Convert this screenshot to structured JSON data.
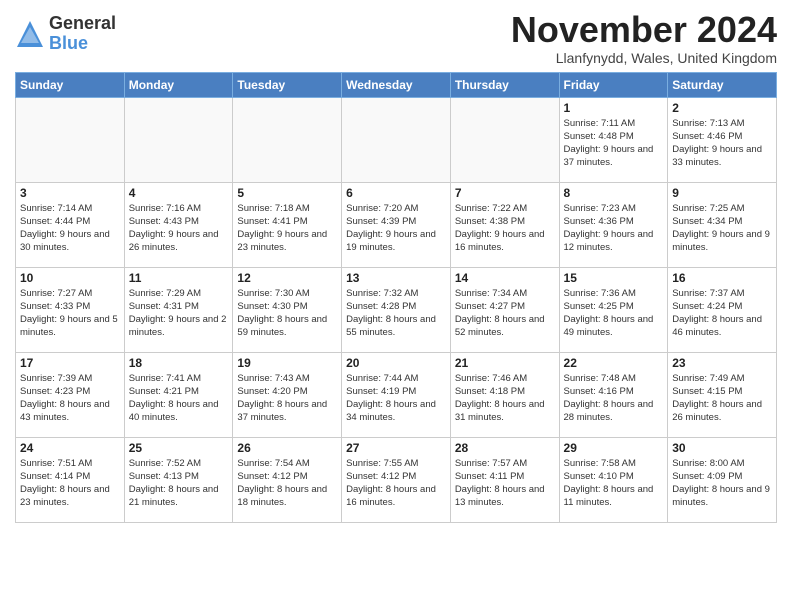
{
  "logo": {
    "general": "General",
    "blue": "Blue"
  },
  "title": "November 2024",
  "location": "Llanfynydd, Wales, United Kingdom",
  "days_header": [
    "Sunday",
    "Monday",
    "Tuesday",
    "Wednesday",
    "Thursday",
    "Friday",
    "Saturday"
  ],
  "weeks": [
    [
      {
        "day": "",
        "info": ""
      },
      {
        "day": "",
        "info": ""
      },
      {
        "day": "",
        "info": ""
      },
      {
        "day": "",
        "info": ""
      },
      {
        "day": "",
        "info": ""
      },
      {
        "day": "1",
        "info": "Sunrise: 7:11 AM\nSunset: 4:48 PM\nDaylight: 9 hours and 37 minutes."
      },
      {
        "day": "2",
        "info": "Sunrise: 7:13 AM\nSunset: 4:46 PM\nDaylight: 9 hours and 33 minutes."
      }
    ],
    [
      {
        "day": "3",
        "info": "Sunrise: 7:14 AM\nSunset: 4:44 PM\nDaylight: 9 hours and 30 minutes."
      },
      {
        "day": "4",
        "info": "Sunrise: 7:16 AM\nSunset: 4:43 PM\nDaylight: 9 hours and 26 minutes."
      },
      {
        "day": "5",
        "info": "Sunrise: 7:18 AM\nSunset: 4:41 PM\nDaylight: 9 hours and 23 minutes."
      },
      {
        "day": "6",
        "info": "Sunrise: 7:20 AM\nSunset: 4:39 PM\nDaylight: 9 hours and 19 minutes."
      },
      {
        "day": "7",
        "info": "Sunrise: 7:22 AM\nSunset: 4:38 PM\nDaylight: 9 hours and 16 minutes."
      },
      {
        "day": "8",
        "info": "Sunrise: 7:23 AM\nSunset: 4:36 PM\nDaylight: 9 hours and 12 minutes."
      },
      {
        "day": "9",
        "info": "Sunrise: 7:25 AM\nSunset: 4:34 PM\nDaylight: 9 hours and 9 minutes."
      }
    ],
    [
      {
        "day": "10",
        "info": "Sunrise: 7:27 AM\nSunset: 4:33 PM\nDaylight: 9 hours and 5 minutes."
      },
      {
        "day": "11",
        "info": "Sunrise: 7:29 AM\nSunset: 4:31 PM\nDaylight: 9 hours and 2 minutes."
      },
      {
        "day": "12",
        "info": "Sunrise: 7:30 AM\nSunset: 4:30 PM\nDaylight: 8 hours and 59 minutes."
      },
      {
        "day": "13",
        "info": "Sunrise: 7:32 AM\nSunset: 4:28 PM\nDaylight: 8 hours and 55 minutes."
      },
      {
        "day": "14",
        "info": "Sunrise: 7:34 AM\nSunset: 4:27 PM\nDaylight: 8 hours and 52 minutes."
      },
      {
        "day": "15",
        "info": "Sunrise: 7:36 AM\nSunset: 4:25 PM\nDaylight: 8 hours and 49 minutes."
      },
      {
        "day": "16",
        "info": "Sunrise: 7:37 AM\nSunset: 4:24 PM\nDaylight: 8 hours and 46 minutes."
      }
    ],
    [
      {
        "day": "17",
        "info": "Sunrise: 7:39 AM\nSunset: 4:23 PM\nDaylight: 8 hours and 43 minutes."
      },
      {
        "day": "18",
        "info": "Sunrise: 7:41 AM\nSunset: 4:21 PM\nDaylight: 8 hours and 40 minutes."
      },
      {
        "day": "19",
        "info": "Sunrise: 7:43 AM\nSunset: 4:20 PM\nDaylight: 8 hours and 37 minutes."
      },
      {
        "day": "20",
        "info": "Sunrise: 7:44 AM\nSunset: 4:19 PM\nDaylight: 8 hours and 34 minutes."
      },
      {
        "day": "21",
        "info": "Sunrise: 7:46 AM\nSunset: 4:18 PM\nDaylight: 8 hours and 31 minutes."
      },
      {
        "day": "22",
        "info": "Sunrise: 7:48 AM\nSunset: 4:16 PM\nDaylight: 8 hours and 28 minutes."
      },
      {
        "day": "23",
        "info": "Sunrise: 7:49 AM\nSunset: 4:15 PM\nDaylight: 8 hours and 26 minutes."
      }
    ],
    [
      {
        "day": "24",
        "info": "Sunrise: 7:51 AM\nSunset: 4:14 PM\nDaylight: 8 hours and 23 minutes."
      },
      {
        "day": "25",
        "info": "Sunrise: 7:52 AM\nSunset: 4:13 PM\nDaylight: 8 hours and 21 minutes."
      },
      {
        "day": "26",
        "info": "Sunrise: 7:54 AM\nSunset: 4:12 PM\nDaylight: 8 hours and 18 minutes."
      },
      {
        "day": "27",
        "info": "Sunrise: 7:55 AM\nSunset: 4:12 PM\nDaylight: 8 hours and 16 minutes."
      },
      {
        "day": "28",
        "info": "Sunrise: 7:57 AM\nSunset: 4:11 PM\nDaylight: 8 hours and 13 minutes."
      },
      {
        "day": "29",
        "info": "Sunrise: 7:58 AM\nSunset: 4:10 PM\nDaylight: 8 hours and 11 minutes."
      },
      {
        "day": "30",
        "info": "Sunrise: 8:00 AM\nSunset: 4:09 PM\nDaylight: 8 hours and 9 minutes."
      }
    ]
  ]
}
